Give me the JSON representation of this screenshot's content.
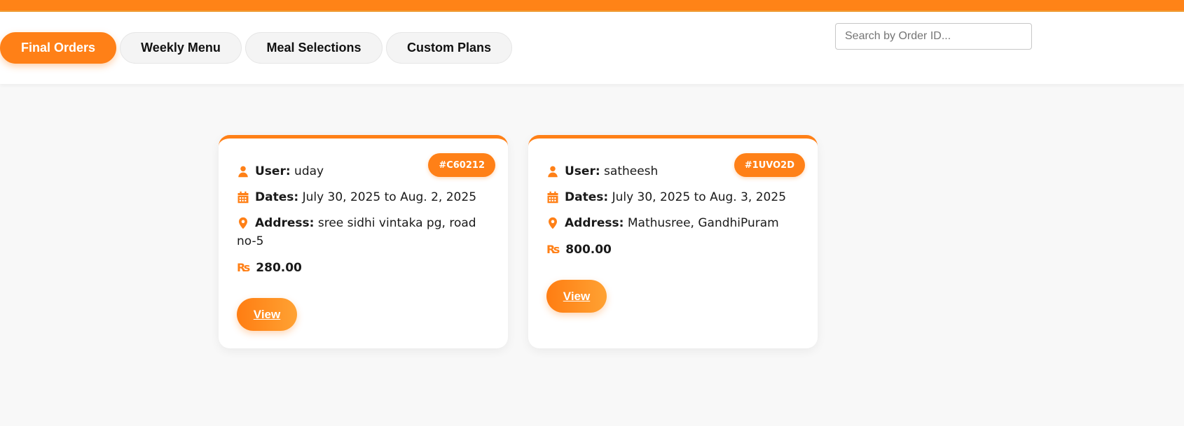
{
  "tabs": [
    {
      "label": "Final Orders",
      "active": true
    },
    {
      "label": "Weekly Menu",
      "active": false
    },
    {
      "label": "Meal Selections",
      "active": false
    },
    {
      "label": "Custom Plans",
      "active": false
    }
  ],
  "search": {
    "placeholder": "Search by Order ID...",
    "value": ""
  },
  "orders": [
    {
      "id": "#C60212",
      "user_label": "User:",
      "user": "uday",
      "dates_label": "Dates:",
      "dates": "July 30, 2025 to Aug. 2, 2025",
      "address_label": "Address:",
      "address": "sree sidhi vintaka pg, road no-5",
      "currency": "₨",
      "amount": "280.00",
      "view_label": "View"
    },
    {
      "id": "#1UVO2D",
      "user_label": "User:",
      "user": "satheesh",
      "dates_label": "Dates:",
      "dates": "July 30, 2025 to Aug. 3, 2025",
      "address_label": "Address:",
      "address": "Mathusree, GandhiPuram",
      "currency": "₨",
      "amount": "800.00",
      "view_label": "View"
    }
  ],
  "icons": {
    "user": "user-icon",
    "dates": "calendar-icon",
    "address": "map-pin-icon",
    "currency": "rupee-icon"
  },
  "colors": {
    "accent": "#ff8017",
    "background": "#f8f8f8",
    "card": "#ffffff"
  }
}
